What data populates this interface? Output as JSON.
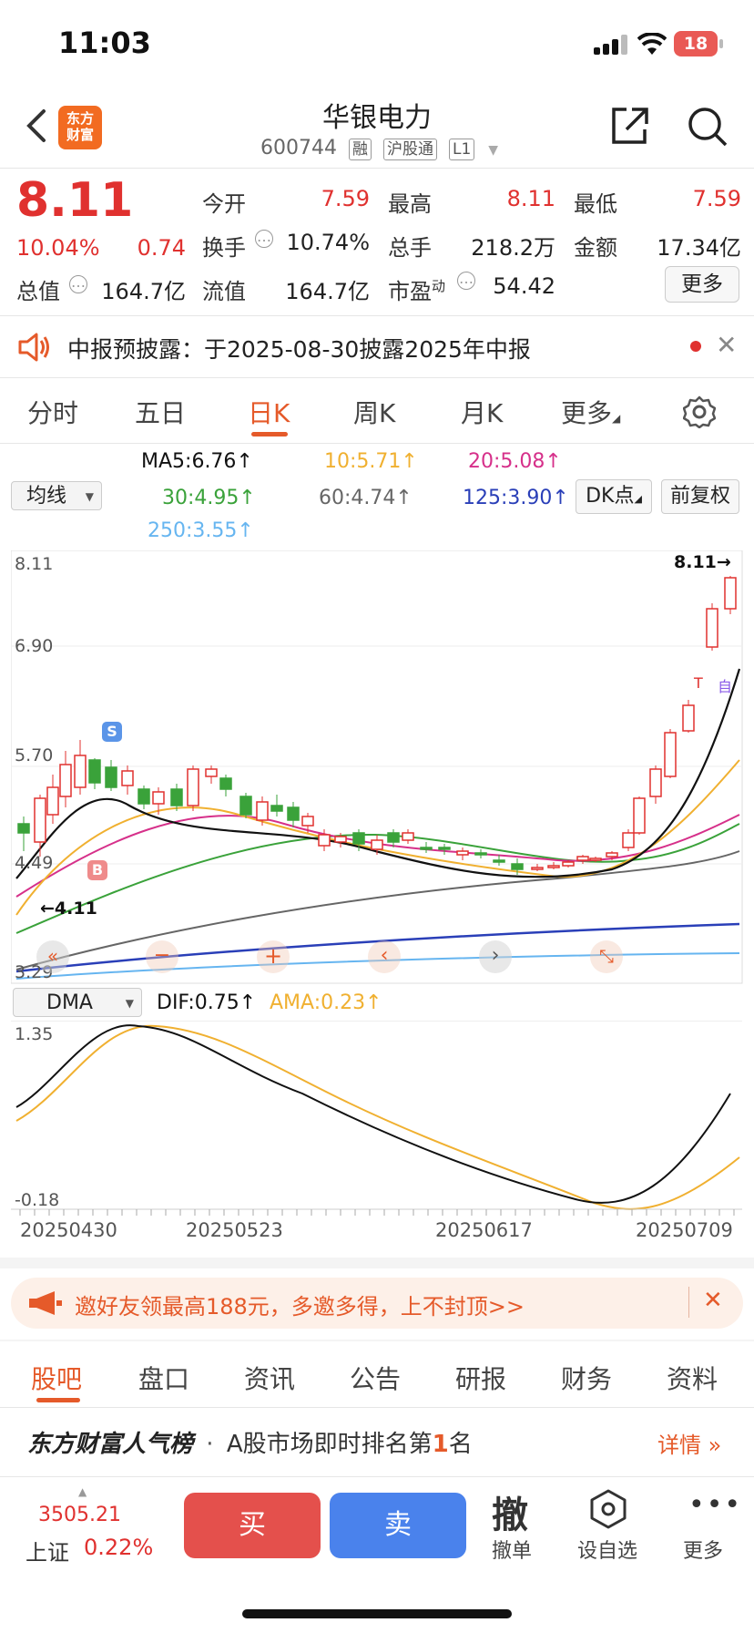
{
  "status_bar": {
    "time": "11:03",
    "battery": "18"
  },
  "header": {
    "logo_text_1": "东方",
    "logo_text_2": "财富",
    "stock_name": "华银电力",
    "stock_code": "600744",
    "tags": [
      "融",
      "沪股通",
      "L1"
    ]
  },
  "quote": {
    "price": "8.11",
    "change_pct": "10.04%",
    "change_abs": "0.74",
    "total_mv_label": "总值",
    "total_mv": "164.7亿",
    "open_label": "今开",
    "open": "7.59",
    "high_label": "最高",
    "high": "8.11",
    "low_label": "最低",
    "low": "7.59",
    "turnover_label": "换手",
    "turnover": "10.74%",
    "volume_label": "总手",
    "volume": "218.2万",
    "amount_label": "金额",
    "amount": "17.34亿",
    "float_mv_label": "流值",
    "float_mv": "164.7亿",
    "pe_label": "市盈",
    "pe_sup": "动",
    "pe": "54.42",
    "more_btn": "更多"
  },
  "notice": {
    "text": "中报预披露：于2025-08-30披露2025年中报"
  },
  "kline_tabs": [
    "分时",
    "五日",
    "日K",
    "周K",
    "月K",
    "更多"
  ],
  "active_tab": "日K",
  "ma_panel": {
    "selector": "均线",
    "ma5": "MA5:6.76",
    "ma10": "10:5.71",
    "ma20": "20:5.08",
    "ma30": "30:4.95",
    "ma60": "60:4.74",
    "ma125": "125:3.90",
    "ma250": "250:3.55",
    "dk_btn": "DK点",
    "adjust_btn": "前复权",
    "colors": {
      "ma5": "#111111",
      "ma10": "#f0b030",
      "ma20": "#d6308a",
      "ma30": "#3aa23a",
      "ma60": "#666666",
      "ma125": "#2a3fb8",
      "ma250": "#66b5f0"
    }
  },
  "price_chart": {
    "y_labels": [
      "8.11",
      "6.90",
      "5.70",
      "4.49",
      "3.29"
    ],
    "max_marker": "8.11",
    "min_marker": "4.11",
    "signal_s": "S",
    "signal_b": "B",
    "signal_t": "T",
    "signal_d": "自"
  },
  "dma_panel": {
    "selector": "DMA",
    "dif": "DIF:0.75",
    "ama": "AMA:0.23",
    "y_top": "1.35",
    "y_bottom": "-0.18"
  },
  "chart_data": {
    "type": "candlestick",
    "y_range": [
      3.29,
      8.11
    ],
    "x_labels": [
      "20250430",
      "20250523",
      "20250617",
      "20250709"
    ],
    "last_close": 8.11,
    "dma_range": [
      -0.18,
      1.35
    ]
  },
  "promo": {
    "text": "邀好友领最高188元，多邀多得，上不封顶>>"
  },
  "bottom_tabs": [
    "股吧",
    "盘口",
    "资讯",
    "公告",
    "研报",
    "财务",
    "资料"
  ],
  "active_bottom_tab": "股吧",
  "popularity": {
    "brand": "东方财富人气榜",
    "sep": "·",
    "text_pre": "A股市场即时排名第",
    "rank": "1",
    "text_post": "名",
    "detail": "详情"
  },
  "action_bar": {
    "index_value": "3505.21",
    "index_name": "上证",
    "index_change": "0.22%",
    "buy": "买",
    "sell": "卖",
    "cancel_icon_char": "撤",
    "cancel_label": "撤单",
    "watch_label": "设自选",
    "more_label": "更多"
  }
}
